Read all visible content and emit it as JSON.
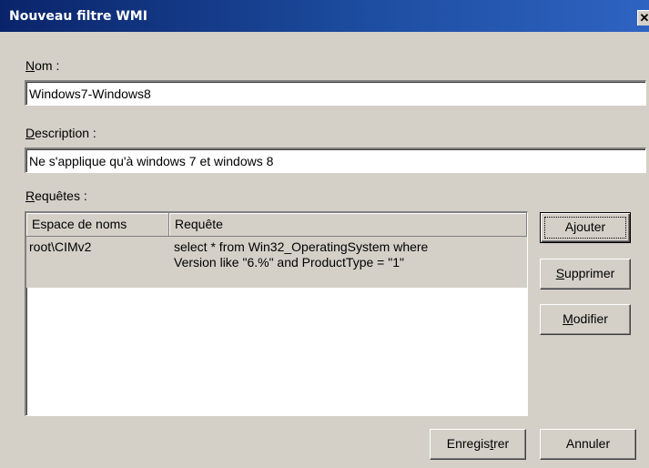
{
  "window": {
    "title": "Nouveau filtre WMI",
    "close_glyph": "✕"
  },
  "name_field": {
    "label_accel": "N",
    "label_rest": "om :",
    "value": "Windows7-Windows8"
  },
  "description_field": {
    "label_accel": "D",
    "label_rest": "escription :",
    "value": "Ne s'applique qu'à windows 7 et windows 8"
  },
  "queries": {
    "label_accel": "R",
    "label_rest": "equêtes :",
    "columns": [
      "Espace de noms",
      "Requête"
    ],
    "rows": [
      {
        "namespace": "root\\CIMv2",
        "query_line1": "select * from Win32_OperatingSystem where",
        "query_line2": "Version like \"6.%\" and ProductType = \"1\""
      }
    ]
  },
  "buttons": {
    "add": {
      "pre": "A",
      "accel": "j",
      "post": "outer"
    },
    "delete": {
      "pre": "",
      "accel": "S",
      "post": "upprimer"
    },
    "edit": {
      "pre": "",
      "accel": "M",
      "post": "odifier"
    },
    "save": {
      "pre": "Enregis",
      "accel": "t",
      "post": "rer"
    },
    "cancel": {
      "pre": "Annuler",
      "accel": "",
      "post": ""
    }
  }
}
